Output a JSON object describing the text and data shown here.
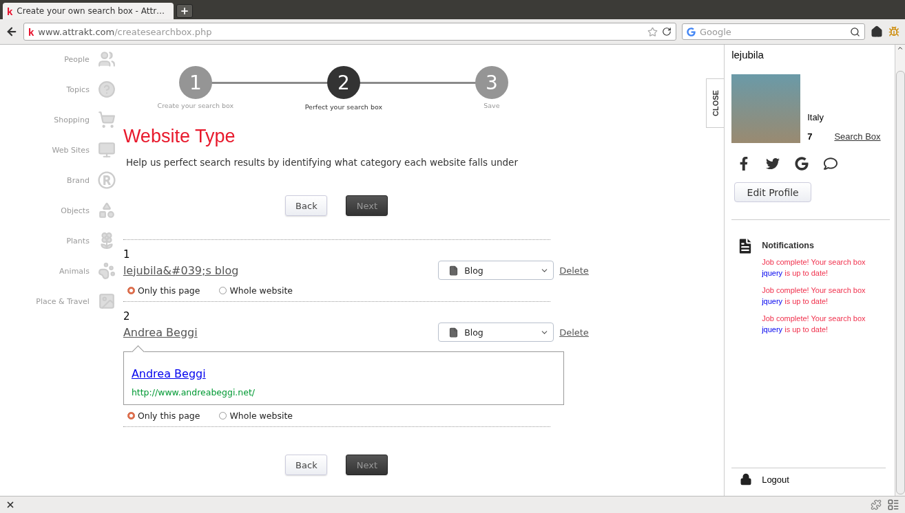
{
  "browser": {
    "logo_letter": "k",
    "url_logo_letter": "k",
    "tab_title": "Create your own search box - Attr…",
    "url_host": "www.attrakt.com",
    "url_path": "/createsearchbox.php",
    "search_placeholder": "Google"
  },
  "sidebar": {
    "items": [
      {
        "label": "People"
      },
      {
        "label": "Topics"
      },
      {
        "label": "Shopping"
      },
      {
        "label": "Web Sites"
      },
      {
        "label": "Brand"
      },
      {
        "label": "Objects"
      },
      {
        "label": "Plants"
      },
      {
        "label": "Animals"
      },
      {
        "label": "Place & Travel"
      }
    ]
  },
  "steps": [
    {
      "number": "1",
      "label": "Create your search box",
      "selected": false
    },
    {
      "number": "2",
      "label": "Perfect your search box",
      "selected": true
    },
    {
      "number": "3",
      "label": "Save",
      "selected": false
    }
  ],
  "heading": "Website Type",
  "description": "Help us perfect search results by identifying what category each website falls under",
  "top_buttons": [
    {
      "label": "Back",
      "disabled": false
    },
    {
      "label": "Next",
      "disabled": true
    }
  ],
  "entries": [
    {
      "number": "1",
      "title": "lejubila&#039;s blog",
      "category": "Blog",
      "delete": "Delete",
      "options": [
        {
          "label": "Only this page",
          "selected": true
        },
        {
          "label": "Whole website",
          "selected": false
        }
      ]
    },
    {
      "number": "2",
      "title": "Andrea Beggi",
      "category": "Blog",
      "delete": "Delete",
      "preview": {
        "title": "Andrea Beggi",
        "url": "http://www.andreabeggi.net/"
      },
      "options": [
        {
          "label": "Only this page",
          "selected": true
        },
        {
          "label": "Whole website",
          "selected": false
        }
      ]
    }
  ],
  "bottom_buttons": [
    {
      "label": "Back",
      "disabled": false
    },
    {
      "label": "Next",
      "disabled": true
    }
  ],
  "close_tab": "CLOSE",
  "profile": {
    "username": "lejubila",
    "country": "Italy",
    "count": "7",
    "link": "Search Box",
    "edit_button": "Edit Profile"
  },
  "notifications": {
    "title": "Notifications",
    "items": [
      {
        "text": "Job complete! Your search box",
        "link": "jquery",
        "suffix": "is up to date!"
      },
      {
        "text": "Job complete! Your search box",
        "link": "jquery",
        "suffix": "is up to date!"
      },
      {
        "text": "Job complete! Your search box",
        "link": "jquery",
        "suffix": "is up to date!"
      }
    ]
  },
  "logout": "Logout"
}
